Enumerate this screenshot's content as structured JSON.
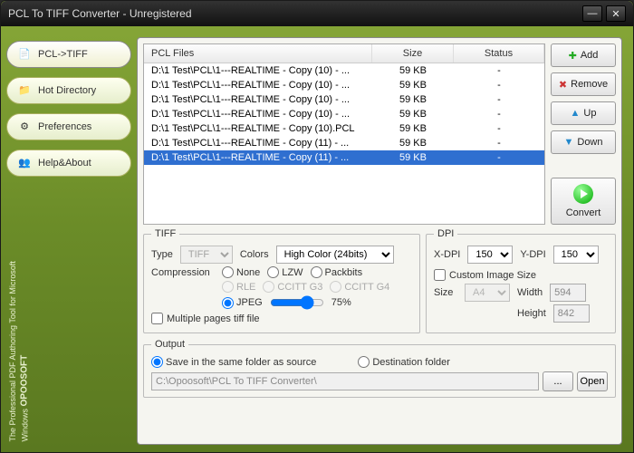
{
  "window": {
    "title": "PCL To TIFF Converter - Unregistered"
  },
  "sidebar": {
    "items": [
      {
        "label": "PCL->TIFF",
        "icon": "pcl-icon"
      },
      {
        "label": "Hot Directory",
        "icon": "folder-icon"
      },
      {
        "label": "Preferences",
        "icon": "gear-icon"
      },
      {
        "label": "Help&About",
        "icon": "help-icon"
      }
    ]
  },
  "brand": {
    "logo": "OPOOSOFT",
    "tagline": "The Professional PDF Authoring Tool for Microsoft Windows"
  },
  "list": {
    "cols": {
      "path": "PCL Files",
      "size": "Size",
      "status": "Status"
    },
    "rows": [
      {
        "path": "D:\\1 Test\\PCL\\1---REALTIME - Copy (10) - ...",
        "size": "59 KB",
        "status": "-"
      },
      {
        "path": "D:\\1 Test\\PCL\\1---REALTIME - Copy (10) - ...",
        "size": "59 KB",
        "status": "-"
      },
      {
        "path": "D:\\1 Test\\PCL\\1---REALTIME - Copy (10) - ...",
        "size": "59 KB",
        "status": "-"
      },
      {
        "path": "D:\\1 Test\\PCL\\1---REALTIME - Copy (10) - ...",
        "size": "59 KB",
        "status": "-"
      },
      {
        "path": "D:\\1 Test\\PCL\\1---REALTIME - Copy (10).PCL",
        "size": "59 KB",
        "status": "-"
      },
      {
        "path": "D:\\1 Test\\PCL\\1---REALTIME - Copy (11) - ...",
        "size": "59 KB",
        "status": "-"
      },
      {
        "path": "D:\\1 Test\\PCL\\1---REALTIME - Copy (11) - ...",
        "size": "59 KB",
        "status": "-"
      }
    ],
    "selected_index": 6
  },
  "buttons": {
    "add": "Add",
    "remove": "Remove",
    "up": "Up",
    "down": "Down",
    "convert": "Convert"
  },
  "tiff": {
    "legend": "TIFF",
    "type_label": "Type",
    "type_value": "TIFF",
    "colors_label": "Colors",
    "colors_value": "High Color (24bits)",
    "compression_label": "Compression",
    "comp": {
      "none": "None",
      "lzw": "LZW",
      "packbits": "Packbits",
      "rle": "RLE",
      "g3": "CCITT G3",
      "g4": "CCITT G4",
      "jpeg": "JPEG"
    },
    "jpeg_quality": "75%",
    "multi_label": "Multiple pages tiff file"
  },
  "dpi": {
    "legend": "DPI",
    "x_label": "X-DPI",
    "x_value": "150",
    "y_label": "Y-DPI",
    "y_value": "150",
    "custom_label": "Custom Image Size",
    "size_label": "Size",
    "size_value": "A4",
    "width_label": "Width",
    "width_value": "594",
    "height_label": "Height",
    "height_value": "842"
  },
  "output": {
    "legend": "Output",
    "same_label": "Save in the same folder as source",
    "dest_label": "Destination folder",
    "path": "C:\\Opoosoft\\PCL To TIFF Converter\\",
    "browse": "...",
    "open": "Open"
  }
}
